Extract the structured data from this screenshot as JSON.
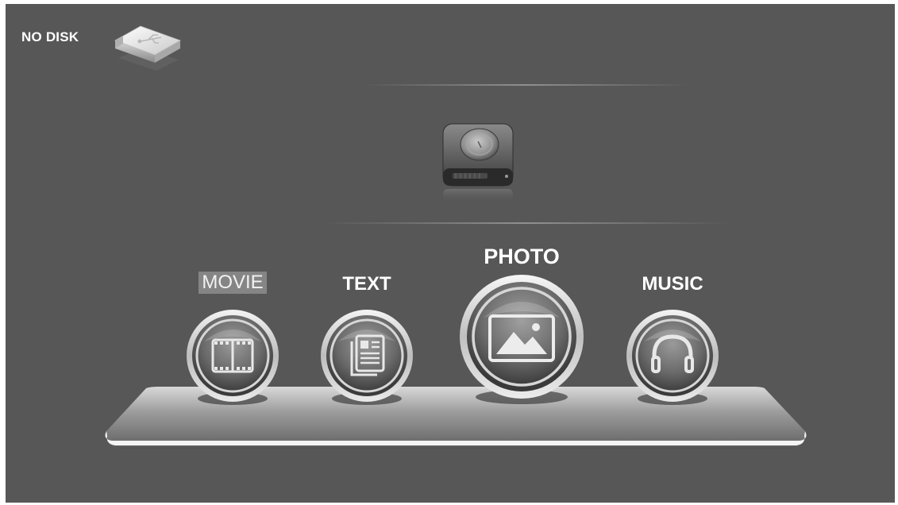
{
  "status": {
    "disk_text": "NO DISK"
  },
  "menu": {
    "items": [
      {
        "label": "MOVIE",
        "icon": "film-icon",
        "state": "selected"
      },
      {
        "label": "TEXT",
        "icon": "document-icon",
        "state": "normal"
      },
      {
        "label": "PHOTO",
        "icon": "image-icon",
        "state": "focused"
      },
      {
        "label": "MUSIC",
        "icon": "headphones-icon",
        "state": "normal"
      }
    ]
  },
  "colors": {
    "background": "#575757",
    "text": "#ffffff",
    "selected_highlight": "#858585"
  }
}
